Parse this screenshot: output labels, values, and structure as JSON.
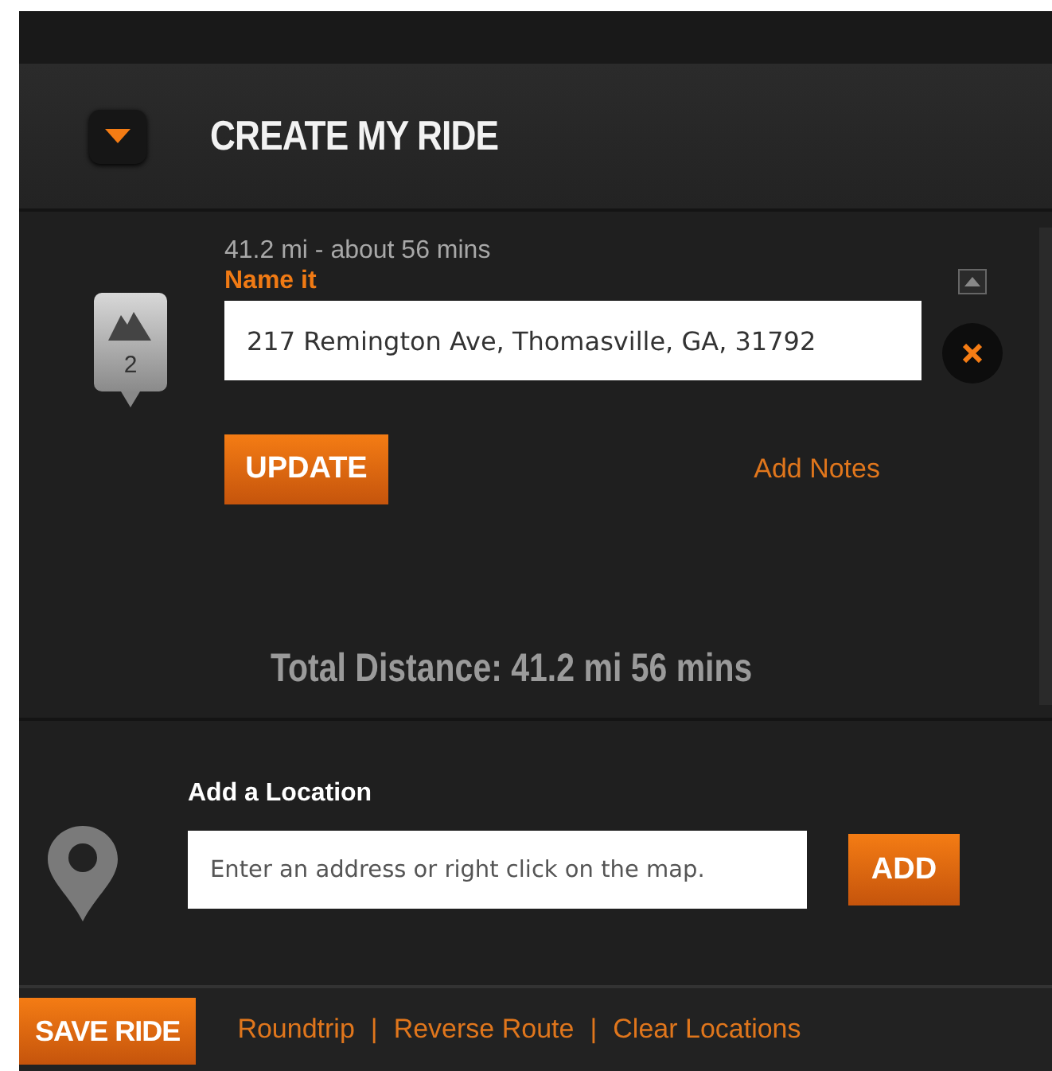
{
  "header": {
    "title": "CREATE MY RIDE",
    "expanded": true
  },
  "stops": [
    {
      "number": "2",
      "summary": "41.2 mi - about 56 mins",
      "name_label": "Name it",
      "address": "217 Remington Ave, Thomasville, GA, 31792",
      "update_button": "UPDATE",
      "notes_link": "Add Notes"
    }
  ],
  "total": "Total Distance: 41.2 mi 56 mins",
  "add_location": {
    "label": "Add a Location",
    "placeholder": "Enter an address or right click on the map.",
    "button": "ADD"
  },
  "footer": {
    "save_button": "SAVE RIDE",
    "links": [
      {
        "label": "Roundtrip"
      },
      {
        "label": "Reverse Route"
      },
      {
        "label": "Clear Locations"
      }
    ],
    "separator": "|"
  }
}
